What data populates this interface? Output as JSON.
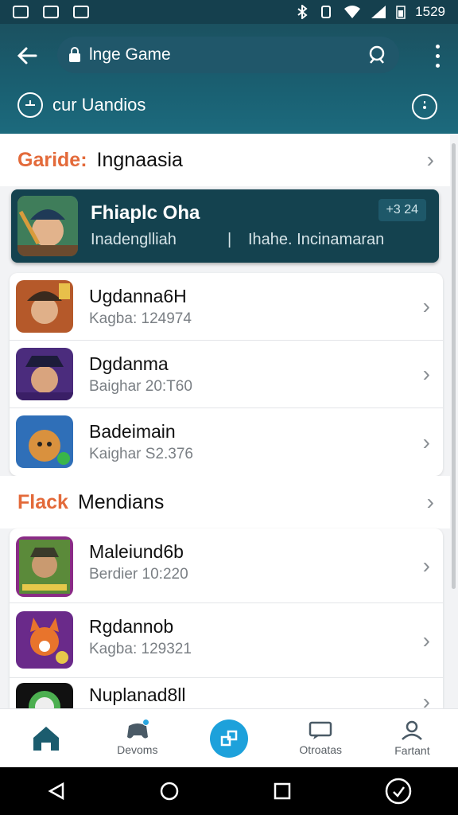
{
  "status_bar": {
    "time": "1529"
  },
  "app_bar": {
    "url_text": "lnge Game",
    "subtitle": "cur Uandios"
  },
  "section1": {
    "tag": "Garide:",
    "title": "Ingnaasia"
  },
  "featured": {
    "title": "Fhiaplc Oha",
    "subtitle": "Inadenglliah",
    "separator": "|",
    "subtitle2": "Ihahe. Incinamaran",
    "badge": "+3 24"
  },
  "list1": [
    {
      "title": "Ugdanna6H",
      "subtitle": "Kagba: 124974"
    },
    {
      "title": "Dgdanma",
      "subtitle": "Baighar 20:T60"
    },
    {
      "title": "Badeimain",
      "subtitle": "Kaighar S2.376"
    }
  ],
  "section2": {
    "tag": "Flack",
    "title": "Mendians"
  },
  "list2": [
    {
      "title": "Maleiund6b",
      "subtitle": "Berdier 10:220"
    },
    {
      "title": "Rgdannob",
      "subtitle": "Kagba: 129321"
    },
    {
      "title": "Nuplanad8ll",
      "subtitle": ""
    }
  ],
  "bottom_nav": [
    {
      "label": "",
      "icon": "home-icon"
    },
    {
      "label": "Devoms",
      "icon": "gamepad-icon"
    },
    {
      "label": "",
      "icon": "apps-icon"
    },
    {
      "label": "Otroatas",
      "icon": "chat-icon"
    },
    {
      "label": "Fartant",
      "icon": "profile-icon"
    }
  ],
  "colors": {
    "header": "#1a6072",
    "accent": "#1da1db",
    "tag": "#e36a3a"
  }
}
